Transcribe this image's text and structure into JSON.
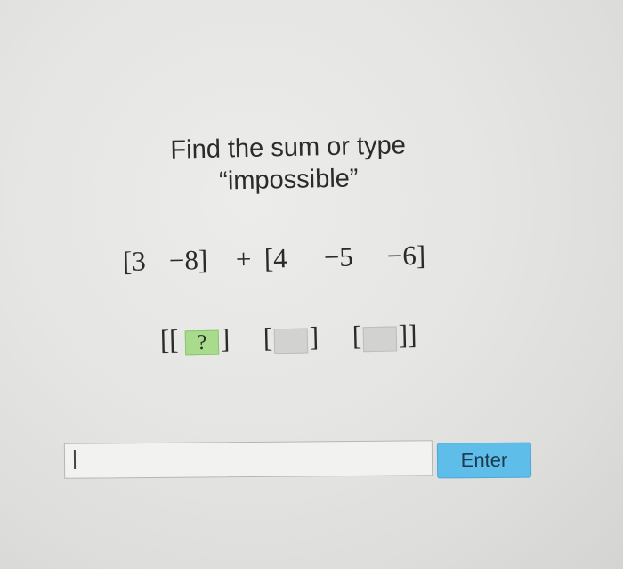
{
  "question": {
    "line1": "Find the sum or type",
    "line2": "“impossible”"
  },
  "equation": {
    "tokens": [
      "[3",
      "−8]",
      "+",
      "[4",
      "−5",
      "−6]"
    ]
  },
  "answer_matrix": {
    "open": "[[",
    "close": "]]",
    "slots": [
      {
        "label": "?",
        "active": true
      },
      {
        "label": "",
        "active": false
      },
      {
        "label": "",
        "active": false
      }
    ],
    "brackets": [
      "]",
      "[",
      "]",
      "["
    ],
    "active_color": "#a8dc8c",
    "empty_color": "#d2d2d0"
  },
  "input": {
    "value": "",
    "placeholder": ""
  },
  "enter_button": {
    "label": "Enter",
    "color": "#5fbde9"
  }
}
